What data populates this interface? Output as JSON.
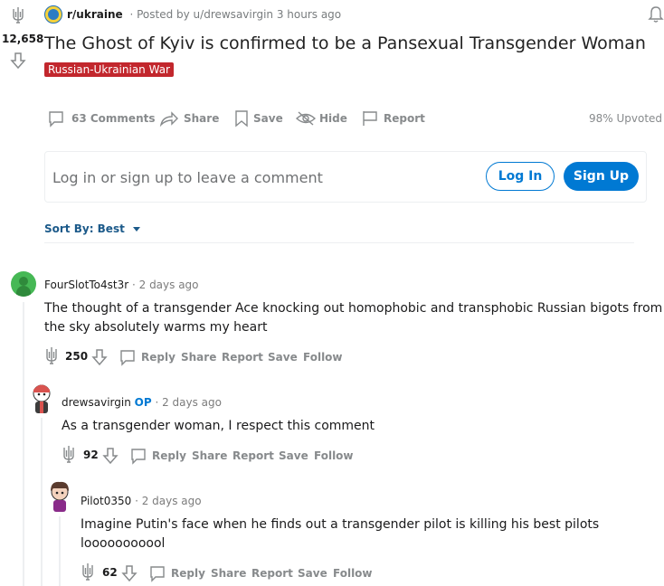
{
  "post": {
    "subreddit": "r/ukraine",
    "posted_by": "· Posted by u/drewsavirgin 3 hours ago",
    "score": "12,658",
    "title": "The Ghost of Kyiv is confirmed to be a Pansexual Transgender Woman",
    "flair": "Russian-Ukrainian War",
    "flair_color": "#c2272d",
    "actions": {
      "comments": "63 Comments",
      "share": "Share",
      "save": "Save",
      "hide": "Hide",
      "report": "Report"
    },
    "upvoted": "98% Upvoted"
  },
  "comment_box": {
    "prompt": "Log in or sign up to leave a comment",
    "login": "Log In",
    "signup": "Sign Up",
    "accent": "#0079d3"
  },
  "sort": {
    "label": "Sort By: Best"
  },
  "comments": [
    {
      "author": "FourSlotTo4st3r",
      "time": "· 2 days ago",
      "text_lines": [
        "The thought of a transgender Ace knocking out homophobic and transphobic Russian bigots from",
        "the sky absolutely warms my heart"
      ],
      "score": "250",
      "actions": [
        "Reply",
        "Share",
        "Report",
        "Save",
        "Follow"
      ]
    },
    {
      "author": "drewsavirgin",
      "op": "OP",
      "time": "· 2 days ago",
      "text_lines": [
        "As a transgender woman, I respect this comment"
      ],
      "score": "92",
      "actions": [
        "Reply",
        "Share",
        "Report",
        "Save",
        "Follow"
      ]
    },
    {
      "author": "Pilot0350",
      "time": "· 2 days ago",
      "text_lines": [
        "Imagine Putin's face when he finds out a transgender pilot is killing his best pilots",
        "looooooooool"
      ],
      "score": "62",
      "actions": [
        "Reply",
        "Share",
        "Report",
        "Save",
        "Follow"
      ]
    }
  ]
}
